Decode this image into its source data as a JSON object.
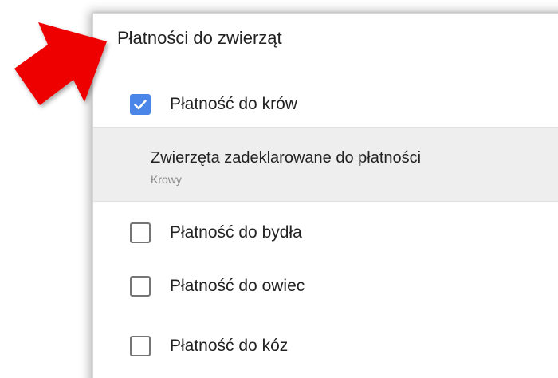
{
  "panel": {
    "title": "Płatności do zwierząt"
  },
  "options": [
    {
      "label": "Płatność do krów",
      "checked": true
    },
    {
      "label": "Płatność do bydła",
      "checked": false
    },
    {
      "label": "Płatność do owiec",
      "checked": false
    },
    {
      "label": "Płatność do kóz",
      "checked": false
    }
  ],
  "detail": {
    "title": "Zwierzęta zadeklarowane do płatności",
    "value": "Krowy"
  },
  "icons": {
    "annotation_arrow": "red-arrow-icon",
    "checkmark": "checkmark-icon"
  },
  "colors": {
    "accent": "#4a86e8",
    "arrow": "#ee0000",
    "detail_background": "#eeeeee"
  }
}
